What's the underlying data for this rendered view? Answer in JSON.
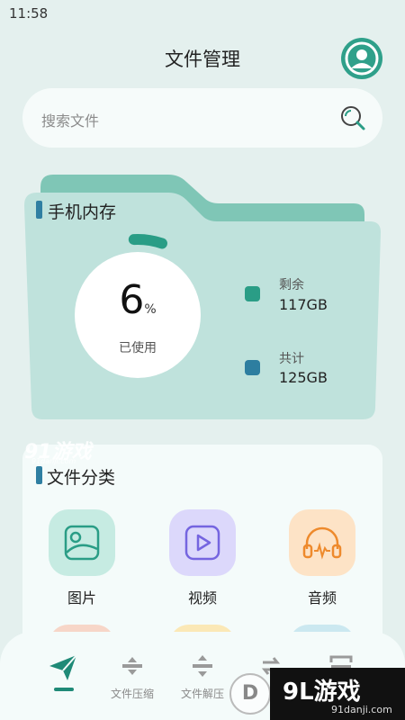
{
  "status_bar": {
    "time": "11:58"
  },
  "header": {
    "title": "文件管理"
  },
  "search": {
    "placeholder": "搜索文件"
  },
  "storage": {
    "title": "手机内存",
    "used_value": "6",
    "used_unit": "%",
    "used_label": "已使用",
    "used_fraction": 0.06,
    "remaining_label": "剩余",
    "remaining_value": "117GB",
    "total_label": "共计",
    "total_value": "125GB"
  },
  "categories": {
    "title": "文件分类",
    "items": [
      {
        "label": "图片",
        "icon": "image-icon"
      },
      {
        "label": "视频",
        "icon": "video-play-icon"
      },
      {
        "label": "音频",
        "icon": "headphones-icon"
      }
    ]
  },
  "bottom_nav": {
    "items": [
      {
        "label": "",
        "icon": "paper-plane-icon",
        "active": true
      },
      {
        "label": "文件压缩",
        "icon": "compress-icon"
      },
      {
        "label": "文件解压",
        "icon": "decompress-icon"
      },
      {
        "label": "",
        "icon": "convert-icon"
      },
      {
        "label": "",
        "icon": "scan-icon"
      }
    ]
  },
  "watermarks": {
    "top_logo": "91游戏",
    "top_sub": "91danji.com",
    "bottom_logo": "9L游戏",
    "bottom_sub": "91danji.com",
    "circle_mark": "D"
  },
  "colors": {
    "background": "#e4f0ee",
    "accent": "#1f8a77",
    "folder_back": "#7fc6b6",
    "folder_front": "#bfe2dc",
    "remaining_dot": "#2a9d86",
    "total_dot": "#2d7ea0",
    "image_tile": "#c6ebe2",
    "video_tile": "#dcd8fb",
    "audio_tile": "#fde3c6"
  }
}
